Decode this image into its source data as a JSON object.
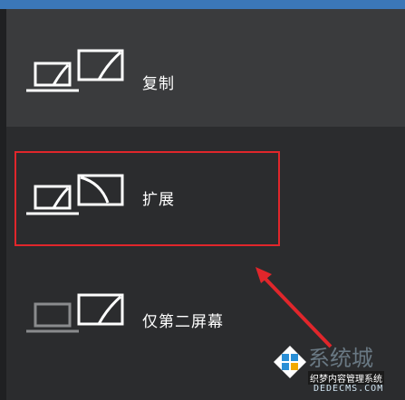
{
  "menu": {
    "options": [
      {
        "label": "复制",
        "icon": "duplicate-display-icon"
      },
      {
        "label": "扩展",
        "icon": "extend-display-icon"
      },
      {
        "label": "仅第二屏幕",
        "icon": "second-screen-only-icon"
      }
    ]
  },
  "colors": {
    "accent": "#3b77b8",
    "selected_bg": "#3a3b3d",
    "panel_bg": "#2b2c2e",
    "highlight": "#e0262b"
  },
  "watermark": {
    "brand": "系统城",
    "tagline": "织梦内容管理系统",
    "url": "DEDECMS.COM"
  }
}
